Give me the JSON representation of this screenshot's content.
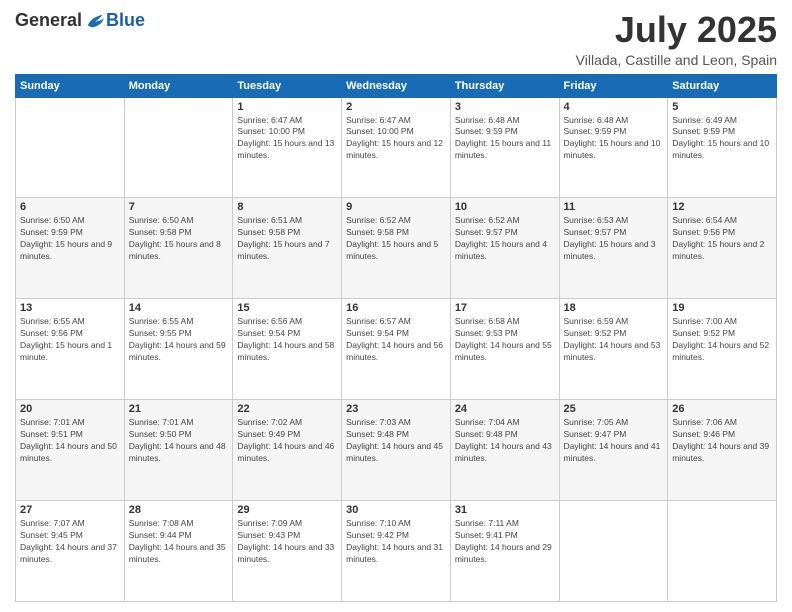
{
  "logo": {
    "general": "General",
    "blue": "Blue"
  },
  "title": "July 2025",
  "subtitle": "Villada, Castille and Leon, Spain",
  "weekdays": [
    "Sunday",
    "Monday",
    "Tuesday",
    "Wednesday",
    "Thursday",
    "Friday",
    "Saturday"
  ],
  "weeks": [
    [
      {
        "day": "",
        "sunrise": "",
        "sunset": "",
        "daylight": ""
      },
      {
        "day": "",
        "sunrise": "",
        "sunset": "",
        "daylight": ""
      },
      {
        "day": "1",
        "sunrise": "Sunrise: 6:47 AM",
        "sunset": "Sunset: 10:00 PM",
        "daylight": "Daylight: 15 hours and 13 minutes."
      },
      {
        "day": "2",
        "sunrise": "Sunrise: 6:47 AM",
        "sunset": "Sunset: 10:00 PM",
        "daylight": "Daylight: 15 hours and 12 minutes."
      },
      {
        "day": "3",
        "sunrise": "Sunrise: 6:48 AM",
        "sunset": "Sunset: 9:59 PM",
        "daylight": "Daylight: 15 hours and 11 minutes."
      },
      {
        "day": "4",
        "sunrise": "Sunrise: 6:48 AM",
        "sunset": "Sunset: 9:59 PM",
        "daylight": "Daylight: 15 hours and 10 minutes."
      },
      {
        "day": "5",
        "sunrise": "Sunrise: 6:49 AM",
        "sunset": "Sunset: 9:59 PM",
        "daylight": "Daylight: 15 hours and 10 minutes."
      }
    ],
    [
      {
        "day": "6",
        "sunrise": "Sunrise: 6:50 AM",
        "sunset": "Sunset: 9:59 PM",
        "daylight": "Daylight: 15 hours and 9 minutes."
      },
      {
        "day": "7",
        "sunrise": "Sunrise: 6:50 AM",
        "sunset": "Sunset: 9:58 PM",
        "daylight": "Daylight: 15 hours and 8 minutes."
      },
      {
        "day": "8",
        "sunrise": "Sunrise: 6:51 AM",
        "sunset": "Sunset: 9:58 PM",
        "daylight": "Daylight: 15 hours and 7 minutes."
      },
      {
        "day": "9",
        "sunrise": "Sunrise: 6:52 AM",
        "sunset": "Sunset: 9:58 PM",
        "daylight": "Daylight: 15 hours and 5 minutes."
      },
      {
        "day": "10",
        "sunrise": "Sunrise: 6:52 AM",
        "sunset": "Sunset: 9:57 PM",
        "daylight": "Daylight: 15 hours and 4 minutes."
      },
      {
        "day": "11",
        "sunrise": "Sunrise: 6:53 AM",
        "sunset": "Sunset: 9:57 PM",
        "daylight": "Daylight: 15 hours and 3 minutes."
      },
      {
        "day": "12",
        "sunrise": "Sunrise: 6:54 AM",
        "sunset": "Sunset: 9:56 PM",
        "daylight": "Daylight: 15 hours and 2 minutes."
      }
    ],
    [
      {
        "day": "13",
        "sunrise": "Sunrise: 6:55 AM",
        "sunset": "Sunset: 9:56 PM",
        "daylight": "Daylight: 15 hours and 1 minute."
      },
      {
        "day": "14",
        "sunrise": "Sunrise: 6:55 AM",
        "sunset": "Sunset: 9:55 PM",
        "daylight": "Daylight: 14 hours and 59 minutes."
      },
      {
        "day": "15",
        "sunrise": "Sunrise: 6:56 AM",
        "sunset": "Sunset: 9:54 PM",
        "daylight": "Daylight: 14 hours and 58 minutes."
      },
      {
        "day": "16",
        "sunrise": "Sunrise: 6:57 AM",
        "sunset": "Sunset: 9:54 PM",
        "daylight": "Daylight: 14 hours and 56 minutes."
      },
      {
        "day": "17",
        "sunrise": "Sunrise: 6:58 AM",
        "sunset": "Sunset: 9:53 PM",
        "daylight": "Daylight: 14 hours and 55 minutes."
      },
      {
        "day": "18",
        "sunrise": "Sunrise: 6:59 AM",
        "sunset": "Sunset: 9:52 PM",
        "daylight": "Daylight: 14 hours and 53 minutes."
      },
      {
        "day": "19",
        "sunrise": "Sunrise: 7:00 AM",
        "sunset": "Sunset: 9:52 PM",
        "daylight": "Daylight: 14 hours and 52 minutes."
      }
    ],
    [
      {
        "day": "20",
        "sunrise": "Sunrise: 7:01 AM",
        "sunset": "Sunset: 9:51 PM",
        "daylight": "Daylight: 14 hours and 50 minutes."
      },
      {
        "day": "21",
        "sunrise": "Sunrise: 7:01 AM",
        "sunset": "Sunset: 9:50 PM",
        "daylight": "Daylight: 14 hours and 48 minutes."
      },
      {
        "day": "22",
        "sunrise": "Sunrise: 7:02 AM",
        "sunset": "Sunset: 9:49 PM",
        "daylight": "Daylight: 14 hours and 46 minutes."
      },
      {
        "day": "23",
        "sunrise": "Sunrise: 7:03 AM",
        "sunset": "Sunset: 9:48 PM",
        "daylight": "Daylight: 14 hours and 45 minutes."
      },
      {
        "day": "24",
        "sunrise": "Sunrise: 7:04 AM",
        "sunset": "Sunset: 9:48 PM",
        "daylight": "Daylight: 14 hours and 43 minutes."
      },
      {
        "day": "25",
        "sunrise": "Sunrise: 7:05 AM",
        "sunset": "Sunset: 9:47 PM",
        "daylight": "Daylight: 14 hours and 41 minutes."
      },
      {
        "day": "26",
        "sunrise": "Sunrise: 7:06 AM",
        "sunset": "Sunset: 9:46 PM",
        "daylight": "Daylight: 14 hours and 39 minutes."
      }
    ],
    [
      {
        "day": "27",
        "sunrise": "Sunrise: 7:07 AM",
        "sunset": "Sunset: 9:45 PM",
        "daylight": "Daylight: 14 hours and 37 minutes."
      },
      {
        "day": "28",
        "sunrise": "Sunrise: 7:08 AM",
        "sunset": "Sunset: 9:44 PM",
        "daylight": "Daylight: 14 hours and 35 minutes."
      },
      {
        "day": "29",
        "sunrise": "Sunrise: 7:09 AM",
        "sunset": "Sunset: 9:43 PM",
        "daylight": "Daylight: 14 hours and 33 minutes."
      },
      {
        "day": "30",
        "sunrise": "Sunrise: 7:10 AM",
        "sunset": "Sunset: 9:42 PM",
        "daylight": "Daylight: 14 hours and 31 minutes."
      },
      {
        "day": "31",
        "sunrise": "Sunrise: 7:11 AM",
        "sunset": "Sunset: 9:41 PM",
        "daylight": "Daylight: 14 hours and 29 minutes."
      },
      {
        "day": "",
        "sunrise": "",
        "sunset": "",
        "daylight": ""
      },
      {
        "day": "",
        "sunrise": "",
        "sunset": "",
        "daylight": ""
      }
    ]
  ]
}
